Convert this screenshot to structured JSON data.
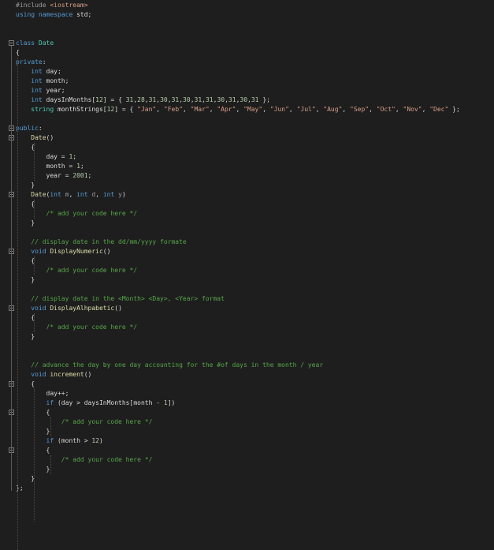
{
  "colors": {
    "background": "#1e1e1e",
    "plain": "#dadada",
    "keyword": "#569cd6",
    "type": "#4ec9b0",
    "function": "#dcdcaa",
    "number": "#b5cea8",
    "string": "#d69d85",
    "comment": "#57a64a",
    "preprocessor": "#9b9b9b",
    "parameter": "#9a9a9a"
  },
  "icons": {
    "fold": "fold-collapse-icon"
  },
  "code": {
    "lines": [
      [
        [
          "pre",
          "#include "
        ],
        [
          "inc",
          "<iostream>"
        ]
      ],
      [
        [
          "kw",
          "using"
        ],
        [
          "plain",
          " "
        ],
        [
          "kw",
          "namespace"
        ],
        [
          "plain",
          " std;"
        ]
      ],
      [],
      [],
      [
        [
          "kw",
          "class"
        ],
        [
          "plain",
          " "
        ],
        [
          "type",
          "Date"
        ]
      ],
      [
        [
          "plain",
          "{"
        ]
      ],
      [
        [
          "kw",
          "private"
        ],
        [
          "plain",
          ":"
        ]
      ],
      [
        [
          "plain",
          "    "
        ],
        [
          "kw",
          "int"
        ],
        [
          "plain",
          " day;"
        ]
      ],
      [
        [
          "plain",
          "    "
        ],
        [
          "kw",
          "int"
        ],
        [
          "plain",
          " month;"
        ]
      ],
      [
        [
          "plain",
          "    "
        ],
        [
          "kw",
          "int"
        ],
        [
          "plain",
          " year;"
        ]
      ],
      [
        [
          "plain",
          "    "
        ],
        [
          "kw",
          "int"
        ],
        [
          "plain",
          " daysInMonths["
        ],
        [
          "num",
          "12"
        ],
        [
          "plain",
          "] = { "
        ],
        [
          "num",
          "31"
        ],
        [
          "plain",
          ","
        ],
        [
          "num",
          "28"
        ],
        [
          "plain",
          ","
        ],
        [
          "num",
          "31"
        ],
        [
          "plain",
          ","
        ],
        [
          "num",
          "30"
        ],
        [
          "plain",
          ","
        ],
        [
          "num",
          "31"
        ],
        [
          "plain",
          ","
        ],
        [
          "num",
          "30"
        ],
        [
          "plain",
          ","
        ],
        [
          "num",
          "31"
        ],
        [
          "plain",
          ","
        ],
        [
          "num",
          "31"
        ],
        [
          "plain",
          ","
        ],
        [
          "num",
          "30"
        ],
        [
          "plain",
          ","
        ],
        [
          "num",
          "31"
        ],
        [
          "plain",
          ","
        ],
        [
          "num",
          "30"
        ],
        [
          "plain",
          ","
        ],
        [
          "num",
          "31"
        ],
        [
          "plain",
          " };"
        ]
      ],
      [
        [
          "plain",
          "    "
        ],
        [
          "type",
          "string"
        ],
        [
          "plain",
          " monthStrings["
        ],
        [
          "num",
          "12"
        ],
        [
          "plain",
          "] = { "
        ],
        [
          "str",
          "\"Jan\""
        ],
        [
          "plain",
          ", "
        ],
        [
          "str",
          "\"Feb\""
        ],
        [
          "plain",
          ", "
        ],
        [
          "str",
          "\"Mar\""
        ],
        [
          "plain",
          ", "
        ],
        [
          "str",
          "\"Apr\""
        ],
        [
          "plain",
          ", "
        ],
        [
          "str",
          "\"May\""
        ],
        [
          "plain",
          ", "
        ],
        [
          "str",
          "\"Jun\""
        ],
        [
          "plain",
          ", "
        ],
        [
          "str",
          "\"Jul\""
        ],
        [
          "plain",
          ", "
        ],
        [
          "str",
          "\"Aug\""
        ],
        [
          "plain",
          ", "
        ],
        [
          "str",
          "\"Sep\""
        ],
        [
          "plain",
          ", "
        ],
        [
          "str",
          "\"Oct\""
        ],
        [
          "plain",
          ", "
        ],
        [
          "str",
          "\"Nov\""
        ],
        [
          "plain",
          ", "
        ],
        [
          "str",
          "\"Dec\""
        ],
        [
          "plain",
          " };"
        ]
      ],
      [],
      [
        [
          "kw",
          "public"
        ],
        [
          "plain",
          ":"
        ]
      ],
      [
        [
          "plain",
          "    "
        ],
        [
          "func",
          "Date"
        ],
        [
          "plain",
          "()"
        ]
      ],
      [
        [
          "plain",
          "    {"
        ]
      ],
      [
        [
          "plain",
          "        day = "
        ],
        [
          "num",
          "1"
        ],
        [
          "plain",
          ";"
        ]
      ],
      [
        [
          "plain",
          "        month = "
        ],
        [
          "num",
          "1"
        ],
        [
          "plain",
          ";"
        ]
      ],
      [
        [
          "plain",
          "        year = "
        ],
        [
          "num",
          "2001"
        ],
        [
          "plain",
          ";"
        ]
      ],
      [
        [
          "plain",
          "    }"
        ]
      ],
      [
        [
          "plain",
          "    "
        ],
        [
          "func",
          "Date"
        ],
        [
          "plain",
          "("
        ],
        [
          "kw",
          "int"
        ],
        [
          "plain",
          " "
        ],
        [
          "param",
          "m"
        ],
        [
          "plain",
          ", "
        ],
        [
          "kw",
          "int"
        ],
        [
          "plain",
          " "
        ],
        [
          "param",
          "d"
        ],
        [
          "plain",
          ", "
        ],
        [
          "kw",
          "int"
        ],
        [
          "plain",
          " "
        ],
        [
          "param",
          "y"
        ],
        [
          "plain",
          ")"
        ]
      ],
      [
        [
          "plain",
          "    {"
        ]
      ],
      [
        [
          "plain",
          "        "
        ],
        [
          "com",
          "/* add your code here */"
        ]
      ],
      [
        [
          "plain",
          "    }"
        ]
      ],
      [],
      [
        [
          "plain",
          "    "
        ],
        [
          "com",
          "// display date in the dd/mm/yyyy formate"
        ]
      ],
      [
        [
          "plain",
          "    "
        ],
        [
          "kw",
          "void"
        ],
        [
          "plain",
          " "
        ],
        [
          "func",
          "DisplayNumeric"
        ],
        [
          "plain",
          "()"
        ]
      ],
      [
        [
          "plain",
          "    {"
        ]
      ],
      [
        [
          "plain",
          "        "
        ],
        [
          "com",
          "/* add your code here */"
        ]
      ],
      [
        [
          "plain",
          "    }"
        ]
      ],
      [],
      [
        [
          "plain",
          "    "
        ],
        [
          "com",
          "// display date in the <Month> <Day>, <Year> format"
        ]
      ],
      [
        [
          "plain",
          "    "
        ],
        [
          "kw",
          "void"
        ],
        [
          "plain",
          " "
        ],
        [
          "func",
          "DisplayAlhpabetic"
        ],
        [
          "plain",
          "()"
        ]
      ],
      [
        [
          "plain",
          "    {"
        ]
      ],
      [
        [
          "plain",
          "        "
        ],
        [
          "com",
          "/* add your code here */"
        ]
      ],
      [
        [
          "plain",
          "    }"
        ]
      ],
      [],
      [],
      [
        [
          "plain",
          "    "
        ],
        [
          "com",
          "// advance the day by one day accounting for the #of days in the month / year"
        ]
      ],
      [
        [
          "plain",
          "    "
        ],
        [
          "kw",
          "void"
        ],
        [
          "plain",
          " "
        ],
        [
          "func",
          "increment"
        ],
        [
          "plain",
          "()"
        ]
      ],
      [
        [
          "plain",
          "    {"
        ]
      ],
      [
        [
          "plain",
          "        day++;"
        ]
      ],
      [
        [
          "plain",
          "        "
        ],
        [
          "kw",
          "if"
        ],
        [
          "plain",
          " (day > daysInMonths[month - "
        ],
        [
          "num",
          "1"
        ],
        [
          "plain",
          "])"
        ]
      ],
      [
        [
          "plain",
          "        {"
        ]
      ],
      [
        [
          "plain",
          "            "
        ],
        [
          "com",
          "/* add your code here */"
        ]
      ],
      [
        [
          "plain",
          "        }"
        ]
      ],
      [
        [
          "plain",
          "        "
        ],
        [
          "kw",
          "if"
        ],
        [
          "plain",
          " (month > "
        ],
        [
          "num",
          "12"
        ],
        [
          "plain",
          ")"
        ]
      ],
      [
        [
          "plain",
          "        {"
        ]
      ],
      [
        [
          "plain",
          "            "
        ],
        [
          "com",
          "/* add your code here */"
        ]
      ],
      [
        [
          "plain",
          "        }"
        ]
      ],
      [
        [
          "plain",
          "    }"
        ]
      ],
      [
        [
          "plain",
          "};"
        ]
      ]
    ]
  }
}
